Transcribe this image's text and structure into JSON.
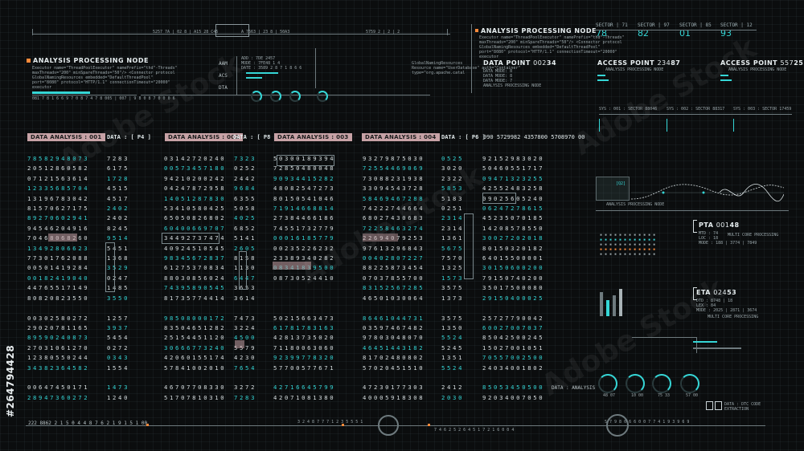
{
  "watermark": {
    "text": "Adobe Stock",
    "id": "#264794428"
  },
  "top_ticker": {
    "left_text": "5257 7A | 02 8 | A15 28 C45",
    "mid_text": "A 7663 | 23 8 | 50A3",
    "right_text": "5759 2 | 2 | 2"
  },
  "node_left": {
    "title": "ANALYSIS PROCESSING NODE",
    "lines": [
      "Executor name=\"ThreadPoolExecutor\" namePrefix=\"thd\"-Threads\"",
      "maxThreads=\"200\" minSpareThreads=\"50\"/> <Connector protocol",
      "GlobalNamingResources embedded=\"DefaultThreadPool\"",
      "port=\"8080\" protocol=\"HTTP/1.1\" connectionTimeout=\"20000\"",
      "executor"
    ],
    "stats": "081   7 8 1 6 6 9 7   0 8 7 4 7 8   005 | 007 | 9  8 0 8 7 0 0 0 6"
  },
  "aac_panel": {
    "labels": [
      "AAM",
      "ACS",
      "DTA"
    ],
    "lines": [
      "ADD : 7DE 2457",
      "MODE : 7FE48 1 4",
      "DATE : 3589 2 8 7 1 8 6 6"
    ]
  },
  "gauge_row": {
    "values": [
      "76 987",
      "18 0871",
      "18 9007"
    ]
  },
  "node_right": {
    "title": "ANALYSIS PROCESSING NODE",
    "lines": [
      "Executor name=\"ThreadPoolExecutor\" namePrefix=\"thd\"-Threads\"",
      "maxThreads=\"200\" minSpareThreads=\"50\"/> <Connector protocol",
      "GlobalNamingResources embedded=\"DefaultThreadPool\"",
      "port=\"8080\" protocol=\"HTTP/1.1\" connectionTimeout=\"20000\"",
      "executor"
    ],
    "res_text": [
      "GlobalNamingResources",
      "Resource name=\"UserDatabase\" auth=\"Container\"",
      "type=\"org.apache.catal"
    ]
  },
  "data_point": {
    "label": "DATA POINT",
    "num": "002",
    "num_hi": "34",
    "rows": [
      "DATA MODE: 8",
      "DATA MODE: 8",
      "DATA MODE: 7",
      "ANALYSIS PROCESSING NODE"
    ]
  },
  "sectors": [
    {
      "label": "SECTOR | 71",
      "value": "78"
    },
    {
      "label": "SECTOR | 97",
      "value": "82"
    },
    {
      "label": "SECTOR | 85",
      "value": "01"
    },
    {
      "label": "SECTOR | 12",
      "value": "93"
    }
  ],
  "access_points": [
    {
      "label": "ACCESS POINT",
      "num": "234",
      "hi": "87",
      "sub": "ANALYSIS PROCESSING NODE"
    },
    {
      "label": "ACCESS POINT",
      "num": "557",
      "hi": "25",
      "sub": "ANALYSIS PROCESSING NODE"
    }
  ],
  "sys_rows": [
    "SYS : 001 : SECTOR 88046",
    "SYS : 002 : SECTOR 88317",
    "SYS : 003 : SECTOR 17459"
  ],
  "analysis_headers": [
    {
      "label": "DATA ANALYSIS : 001",
      "data": "DATA : [ P4 ]"
    },
    {
      "label": "DATA ANALYSIS : 002",
      "data": "DATA : [ P8 ]"
    },
    {
      "label": "DATA ANALYSIS : 003",
      "data": ""
    },
    {
      "label": "DATA ANALYSIS : 004",
      "data": "DATA : [ P6 ]"
    }
  ],
  "top_number_row": "090  5729982  4357800  5708970  00",
  "columns": [
    [
      "78582948073",
      "20512860582",
      "07121563614",
      "12335685704",
      "13196783042",
      "81570627175",
      "89270602941",
      "94546204916",
      "70468068260",
      "13492806623",
      "77301762088",
      "00501419284",
      "00182419040",
      "44765517149",
      "80820823550",
      "",
      "00302580272",
      "29020781165",
      "89590240873",
      "27031061270",
      "12380550244",
      "34382364582",
      "",
      "00647450171",
      "28947360272"
    ],
    [
      "7283",
      "6175",
      "1728",
      "4515",
      "4517",
      "2402",
      "2402",
      "8245",
      "9514",
      "5451",
      "1368",
      "3529",
      "0247",
      "1485",
      "3550",
      "",
      "1257",
      "3937",
      "5454",
      "0272",
      "0343",
      "1554",
      "",
      "1473",
      "1240"
    ],
    [
      "03142720240",
      "00573457180",
      "94210200242",
      "04247872958",
      "14051287830",
      "53410580425",
      "65050826802",
      "60400669707",
      "34492737474",
      "40924510545",
      "98345672837",
      "61275370834",
      "88030856024",
      "74395890545",
      "81735774414",
      "",
      "98508000172",
      "83504651282",
      "25154451120",
      "30666773240",
      "42060155174",
      "57841002010",
      "",
      "46707708330",
      "51707810310"
    ],
    [
      "7323",
      "0252",
      "2442",
      "9684",
      "6355",
      "5058",
      "4025",
      "6852",
      "5141",
      "2605",
      "8158",
      "1130",
      "6447",
      "3653",
      "3614",
      "",
      "7473",
      "3224",
      "4500",
      "5579",
      "4230",
      "7654",
      "",
      "3272",
      "7283"
    ],
    [
      "50300189394",
      "72850480048",
      "90934415282",
      "48082547273",
      "80150541046",
      "71914668814",
      "27384466186",
      "74551732779",
      "00016185779",
      "00235226232",
      "23389340282",
      "08341839500",
      "08730524410",
      "",
      "",
      "",
      "50215663473",
      "61781783163",
      "42813735020",
      "71180063060",
      "92399778320",
      "57700577671",
      "",
      "42716645799",
      "42071081380"
    ],
    [
      "93279875030",
      "72554469069",
      "73088231938",
      "33094543728",
      "58469467288",
      "74222744664",
      "68027430683",
      "72258463274",
      "22694079253",
      "97613296843",
      "00402807227",
      "88225873454",
      "07037855700",
      "83152567285",
      "46501030064",
      "",
      "86461044731",
      "03597467482",
      "97803048070",
      "46451443182",
      "81702480802",
      "57020451510",
      "",
      "47230177303",
      "40005918308"
    ],
    [
      "0525",
      "3020",
      "2322",
      "5853",
      "5183",
      "0251",
      "2314",
      "2314",
      "1361",
      "5675",
      "7570",
      "1325",
      "1573",
      "3575",
      "1373",
      "",
      "3575",
      "1350",
      "5524",
      "5245",
      "1351",
      "5524",
      "",
      "2412",
      "2030"
    ],
    [
      "92152983020",
      "50460551717",
      "09471323255",
      "42552483258",
      "09025605240",
      "06247278615",
      "45235070185",
      "14208578550",
      "30027202018",
      "80150320182",
      "64015500001",
      "30150600200",
      "79150740200",
      "35017500080",
      "29150400025",
      "",
      "25727790042",
      "60027007037",
      "85042500245",
      "15027001051",
      "70557002500",
      "24034001802",
      "",
      "85053450500",
      "92034007050"
    ]
  ],
  "chart_panel": {
    "value": "[Q2]",
    "label": "ANALYSIS PROCESSING NODE"
  },
  "pta": {
    "label": "PTA",
    "num": "001",
    "hi": "48",
    "rows": [
      "MTD : 74",
      "LOC : 18",
      "MODE : 188 | 3774 | 7849"
    ],
    "sub": "MULTI CORE PROCESSING"
  },
  "eta": {
    "label": "ETA",
    "num": "024",
    "hi": "53",
    "rows": [
      "DTD : 8748 | 18",
      "LEX : 84",
      "MODE : 2025 | 2871 | 3674"
    ],
    "sub": "MULTI CORE PROCESSING"
  },
  "bottom_gauges": {
    "label": "DATA : ANALYSIS",
    "values": [
      "48 07",
      "10 00",
      "75 33",
      "57 00"
    ]
  },
  "dtc": {
    "label": "DATA : DTC CODE",
    "sub": "EXTRACTION"
  },
  "bottom_ticker": {
    "left": "222   8862 2 1 5 0 4 4 8   7 6 2 1 9 1 5 1 00",
    "mid": "3 2 4 8 7  7 7 1 2   3 5   5 5 1",
    "mid2": "7 4 6 2 5   2 6 4   5 1 7   2 1 6   0 0 4",
    "right": "5 7 9 8 0   6 6 0 0   7 7   4 1 9   3 9 6 9"
  },
  "colors": {
    "accent": "#35d6d6",
    "orange": "#ff8a3a",
    "label_bg": "#c7a2a6",
    "bg": "#0b0d0e"
  }
}
